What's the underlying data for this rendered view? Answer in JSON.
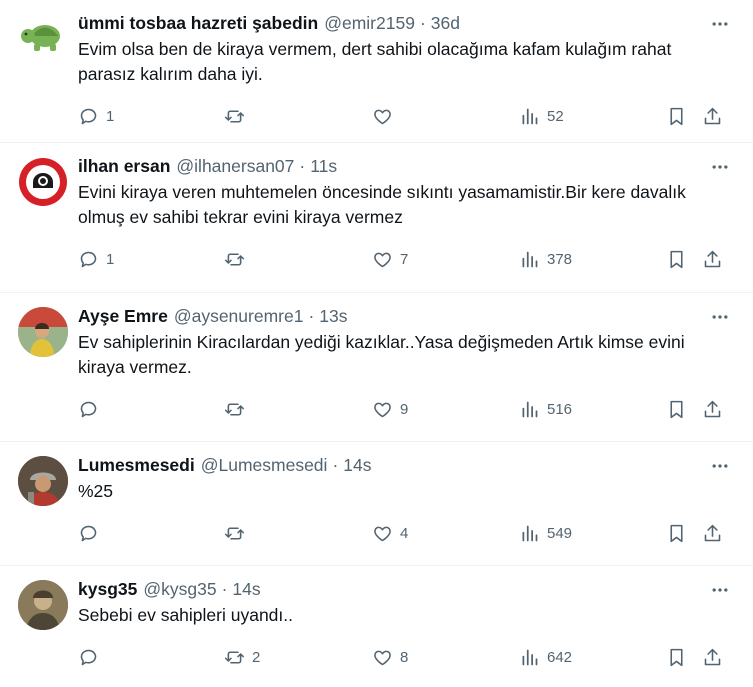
{
  "tweets": [
    {
      "name": "ümmi tosbaa hazreti şabedin",
      "handle": "@emir2159",
      "time": "36d",
      "text": "Evim olsa ben de kiraya vermem, dert sahibi olacağıma kafam kulağım rahat parasız kalırım daha iyi.",
      "replies": "1",
      "retweets": "",
      "likes": "",
      "views": "52",
      "avatar": "turtle-avatar"
    },
    {
      "name": "ilhan ersan",
      "handle": "@ilhanersan07",
      "time": "11s",
      "text": "Evini kiraya veren muhtemelen öncesinde sıkıntı yasamamistir.Bir kere davalık olmuş ev sahibi tekrar evini kiraya vermez",
      "replies": "1",
      "retweets": "",
      "likes": "7",
      "views": "378",
      "avatar": "club-logo-avatar"
    },
    {
      "name": "Ayşe Emre",
      "handle": "@aysenuremre1",
      "time": "13s",
      "text": "Ev sahiplerinin Kiracılardan yediği kazıklar..Yasa değişmeden Artık kimse evini kiraya vermez.",
      "replies": "",
      "retweets": "",
      "likes": "9",
      "views": "516",
      "avatar": "photo-avatar"
    },
    {
      "name": "Lumesmesedi",
      "handle": "@Lumesmesedi",
      "time": "14s",
      "text": "%25",
      "replies": "",
      "retweets": "",
      "likes": "4",
      "views": "549",
      "avatar": "warrior-avatar"
    },
    {
      "name": "kysg35",
      "handle": "@kysg35",
      "time": "14s",
      "text": "Sebebi ev sahipleri uyandı..",
      "replies": "",
      "retweets": "2",
      "likes": "8",
      "views": "642",
      "avatar": "portrait-avatar"
    }
  ],
  "colors": {
    "text": "#0f1419",
    "muted": "#536471",
    "divider": "#eff3f4"
  }
}
